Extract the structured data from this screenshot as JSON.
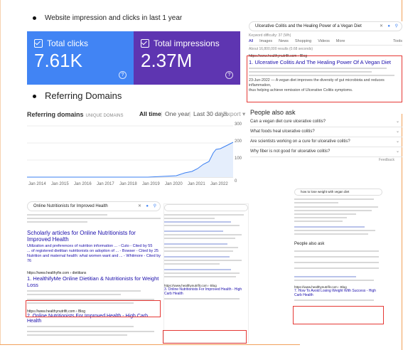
{
  "bullets": {
    "impressions": "Website impression and clicks in last 1 year",
    "domains": "Referring Domains"
  },
  "cards": {
    "clicks": {
      "label": "Total clicks",
      "value": "7.61K",
      "color": "#4184f4"
    },
    "impressions": {
      "label": "Total impressions",
      "value": "2.37M",
      "color": "#5e35b1"
    }
  },
  "referring": {
    "title": "Referring domains",
    "subtitle": "UNIQUE DOMAINS",
    "controls": [
      "All time",
      "One year",
      "Last 30 days",
      "Export"
    ],
    "y_ticks": [
      "300",
      "200",
      "100"
    ],
    "x_ticks": [
      "Jan 2014",
      "Jan 2015",
      "Jan 2016",
      "Jan 2017",
      "Jan 2018",
      "Jan 2019",
      "Jan 2020",
      "Jan 2021",
      "Jan 2022",
      "0"
    ]
  },
  "serp_top": {
    "query": "Ulcerative Colitis and the Healing Power of a Vegan Diet",
    "difficulty": "Keyword difficulty: 37 (Wh)",
    "tabs": [
      "All",
      "Images",
      "News",
      "Shopping",
      "Videos",
      "More",
      "Tools"
    ],
    "stats": "About 16,800,000 results (0.68 seconds)",
    "url": "https://www.healthynutrifit.com › Blog",
    "title": "1. Ulcerative Colitis And The Healing Power Of A Vegan Diet",
    "date": "23-Jun-2022",
    "snippet_a": "— A vegan diet improves the diversity of gut microbiota and reduces inflammation,",
    "snippet_b": "thus helping achieve remission of Ulcerative Colitis symptoms."
  },
  "paa": {
    "title": "People also ask",
    "questions": [
      "Can a vegan diet cure ulcerative colitis?",
      "What foods heal ulcerative colitis?",
      "Are scientists working on a cure for ulcerative colitis?",
      "Why fiber is not good for ulcerative colitis?"
    ],
    "feedback": "Feedback"
  },
  "serp_left": {
    "query": "Online Nutritionists for Improved Health",
    "scholarly": "Scholarly articles for Online Nutritionists for Improved Health",
    "scholar_lines": [
      "Utilization and preferences of nutrition information ... - Cuto - Cited by 55",
      "... of registered dietitian nutritionists on adoption of ... - Bowser - Cited by 25",
      "Nutrition and maternal health: what women want and ... - Whitmore - Cited by 76"
    ],
    "result1_url": "https://www.healthyfie.com › dietitians",
    "result1_title": "1. HealthifyMe Online Dietitian & Nutritionists for Weight Loss",
    "result2_url": "https://www.healthynutrifit.com › Blog",
    "result2_title": "2. Online Nutritionists For Improved Health - High Carb Health"
  },
  "serp_mid": {
    "result_title": "3. Online Nutritionists For Improved Health - High Carb Health",
    "result_url": "https://www.healthynutrifit.com › Blog"
  },
  "serp_right": {
    "query": "how to lose weight with vegan diet",
    "paa": "People also ask",
    "result_title": "7. How To Avoid Losing Weight With Success - High Carb Health",
    "result_url": "https://www.healthynutrifit.com › Blog"
  }
}
